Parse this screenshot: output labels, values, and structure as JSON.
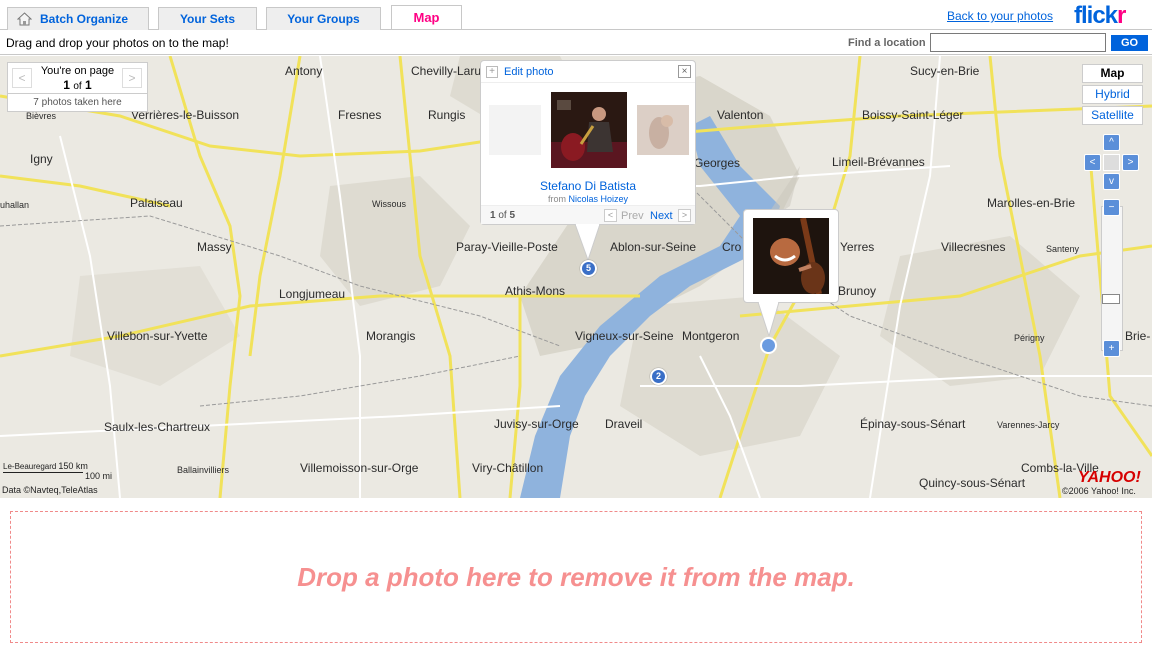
{
  "tabs": [
    {
      "label": "Batch Organize"
    },
    {
      "label": "Your Sets"
    },
    {
      "label": "Your Groups"
    },
    {
      "label": "Map"
    }
  ],
  "header": {
    "back_link": "Back to your photos",
    "logo_part1": "flick",
    "logo_part2": "r"
  },
  "toolbar": {
    "instructions": "Drag and drop your photos on to the map!",
    "find_label": "Find a location",
    "find_value": "",
    "go_label": "GO"
  },
  "pager": {
    "line1": "You're on page",
    "current": "1",
    "of_text": "of",
    "total": "1",
    "photos_taken": "7 photos taken here",
    "prev_arrow": "<",
    "next_arrow": ">"
  },
  "map_types": [
    "Map",
    "Hybrid",
    "Satellite"
  ],
  "nav": {
    "up": "^",
    "down": "v",
    "left": "<",
    "right": ">",
    "zoom_in": "+",
    "zoom_out": "−"
  },
  "popup": {
    "edit_label": "Edit photo",
    "plus": "+",
    "close": "×",
    "title": "Stefano Di Batista",
    "from_prefix": "from",
    "from_user": "Nicolas Hoizey",
    "count_current": "1",
    "count_of": "of",
    "count_total": "5",
    "prev": "Prev",
    "next": "Next",
    "prev_arrow": "<",
    "next_arrow": ">"
  },
  "markers": {
    "cluster_a": "5",
    "cluster_b": "2"
  },
  "places": [
    {
      "name": "Antony"
    },
    {
      "name": "Chevilly-Larue"
    },
    {
      "name": "Sucy-en-Brie"
    },
    {
      "name": "Bièvres"
    },
    {
      "name": "Verrières-le-Buisson"
    },
    {
      "name": "Fresnes"
    },
    {
      "name": "Rungis"
    },
    {
      "name": "Valenton"
    },
    {
      "name": "Boissy-Saint-Léger"
    },
    {
      "name": "Igny"
    },
    {
      "name": "Georges"
    },
    {
      "name": "Limeil-Brévannes"
    },
    {
      "name": "Palaiseau"
    },
    {
      "name": "Wissous"
    },
    {
      "name": "Marolles-en-Brie"
    },
    {
      "name": "Massy"
    },
    {
      "name": "Paray-Vieille-Poste"
    },
    {
      "name": "Ablon-sur-Seine"
    },
    {
      "name": "Cro"
    },
    {
      "name": "Yerres"
    },
    {
      "name": "Villecresnes"
    },
    {
      "name": "Santeny"
    },
    {
      "name": "Longjumeau"
    },
    {
      "name": "Athis-Mons"
    },
    {
      "name": "Brunoy"
    },
    {
      "name": "Villebon-sur-Yvette"
    },
    {
      "name": "Morangis"
    },
    {
      "name": "Vigneux-sur-Seine"
    },
    {
      "name": "Montgeron"
    },
    {
      "name": "Périgny"
    },
    {
      "name": "Brie-"
    },
    {
      "name": "Saulx-les-Chartreux"
    },
    {
      "name": "Juvisy-sur-Orge"
    },
    {
      "name": "Draveil"
    },
    {
      "name": "Épinay-sous-Sénart"
    },
    {
      "name": "Varennes-Jarcy"
    },
    {
      "name": "Ballainvilliers"
    },
    {
      "name": "Villemoisson-sur-Orge"
    },
    {
      "name": "Viry-Châtillon"
    },
    {
      "name": "Combs-la-Ville"
    },
    {
      "name": "Quincy-sous-Sénart"
    },
    {
      "name": "uhallan"
    }
  ],
  "map_footer": {
    "scale_km": "150 km",
    "scale_mi": "100 mi",
    "scale_place": "Le-Beauregard",
    "attribution": "Data ©Navteq,TeleAtlas",
    "yahoo": "YAHOO!",
    "copyright": "©2006 Yahoo! Inc."
  },
  "dropzone": {
    "text": "Drop a photo here to remove it from the map."
  },
  "colors": {
    "accent": "#0063dc",
    "brand_pink": "#ff0084",
    "water": "#8fb3dd",
    "drop_text": "#f69090"
  }
}
